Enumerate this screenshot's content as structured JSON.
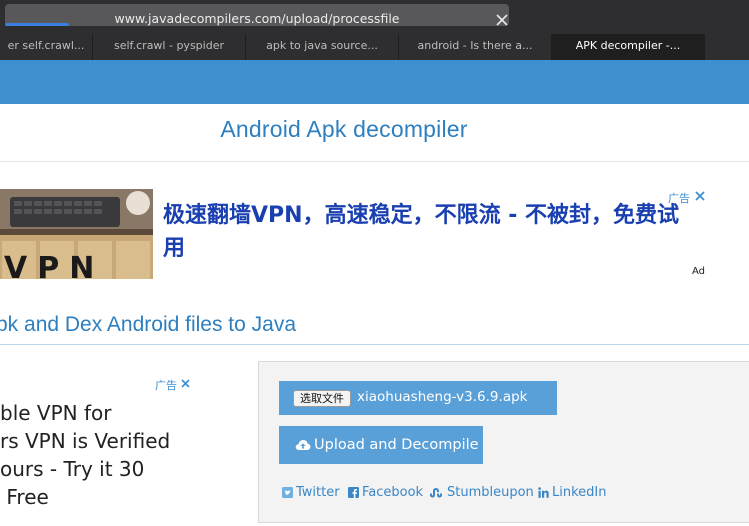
{
  "browser": {
    "url": "www.javadecompilers.com/upload/processfile",
    "tabs": [
      {
        "label": "er self.crawl..."
      },
      {
        "label": "self.crawl - pyspider"
      },
      {
        "label": "apk to java source..."
      },
      {
        "label": "android - Is there a..."
      },
      {
        "label": "APK decompiler -..."
      }
    ],
    "active_tab_index": 4
  },
  "page": {
    "title": "Android Apk decompiler",
    "section_heading": "pk and Dex Android files to Java"
  },
  "ad_top": {
    "text": "极速翻墙VPN，高速稳定，不限流 - 不被封，免费试用",
    "choices_label": "广告",
    "ad_label": "Ad",
    "image_text": "VPN"
  },
  "ad_side": {
    "choices_label": "广告",
    "lines": [
      "ble VPN for",
      "rs VPN is Verified",
      "ours - Try it 30",
      " Free"
    ]
  },
  "upload": {
    "choose_file_label": "选取文件",
    "file_name": "xiaohuasheng-v3.6.9.apk",
    "button_label": "Upload and Decompile"
  },
  "share": {
    "twitter": "Twitter",
    "facebook": "Facebook",
    "stumbleupon": "Stumbleupon",
    "linkedin": "LinkedIn"
  },
  "colors": {
    "header_blue": "#3d8fd0",
    "title_blue": "#2d7fbf",
    "button_blue": "#5aa0d8",
    "ad_text_blue": "#1a3fb0"
  }
}
